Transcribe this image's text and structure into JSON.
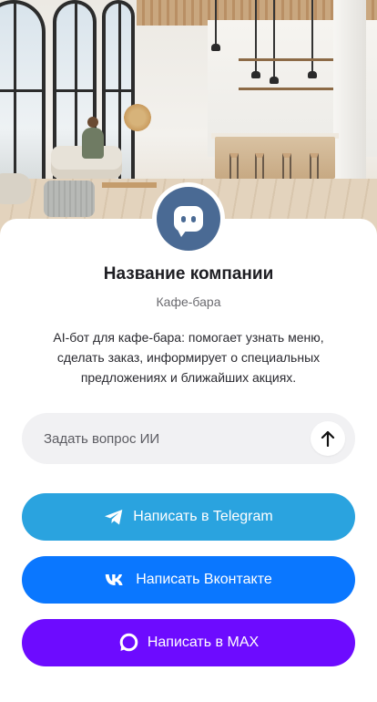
{
  "company": {
    "name": "Название компании",
    "type": "Кафе-бара",
    "description": "AI-бот для кафе-бара: помогает узнать меню, сделать заказ, информирует о специальных предложениях и ближайших акциях."
  },
  "ask": {
    "placeholder": "Задать вопрос ИИ",
    "value": "",
    "send_icon": "arrow-up-icon"
  },
  "buttons": {
    "telegram": {
      "label": "Написать в Telegram",
      "icon": "telegram-icon",
      "color": "#2aa3df"
    },
    "vk": {
      "label": "Написать Вконтакте",
      "icon": "vk-icon",
      "color": "#0a77ff"
    },
    "max": {
      "label": "Написать в MAX",
      "icon": "max-icon",
      "color": "#6d0bff"
    }
  },
  "avatar": {
    "icon": "chat-bot-icon",
    "color": "#4a6a94"
  }
}
